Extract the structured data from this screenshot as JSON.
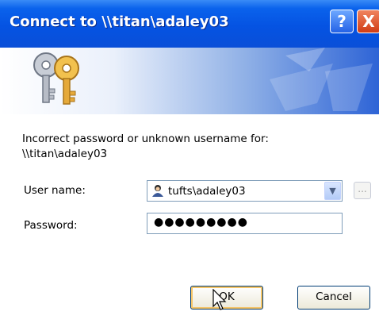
{
  "window": {
    "title": "Connect to \\\\titan\\adaley03",
    "help_label": "?",
    "close_label": "X"
  },
  "message": {
    "line1": "Incorrect password or unknown username for:",
    "line2": "\\\\titan\\adaley03"
  },
  "form": {
    "username_label": "User name:",
    "username_value": "tufts\\adaley03",
    "browse_label": "...",
    "password_label": "Password:",
    "password_value": "●●●●●●●●●"
  },
  "buttons": {
    "ok_label": "OK",
    "cancel_label": "Cancel"
  },
  "icons": [
    "keys-icon",
    "user-icon",
    "chevron-down-icon",
    "help-icon",
    "close-icon",
    "cursor-icon"
  ]
}
